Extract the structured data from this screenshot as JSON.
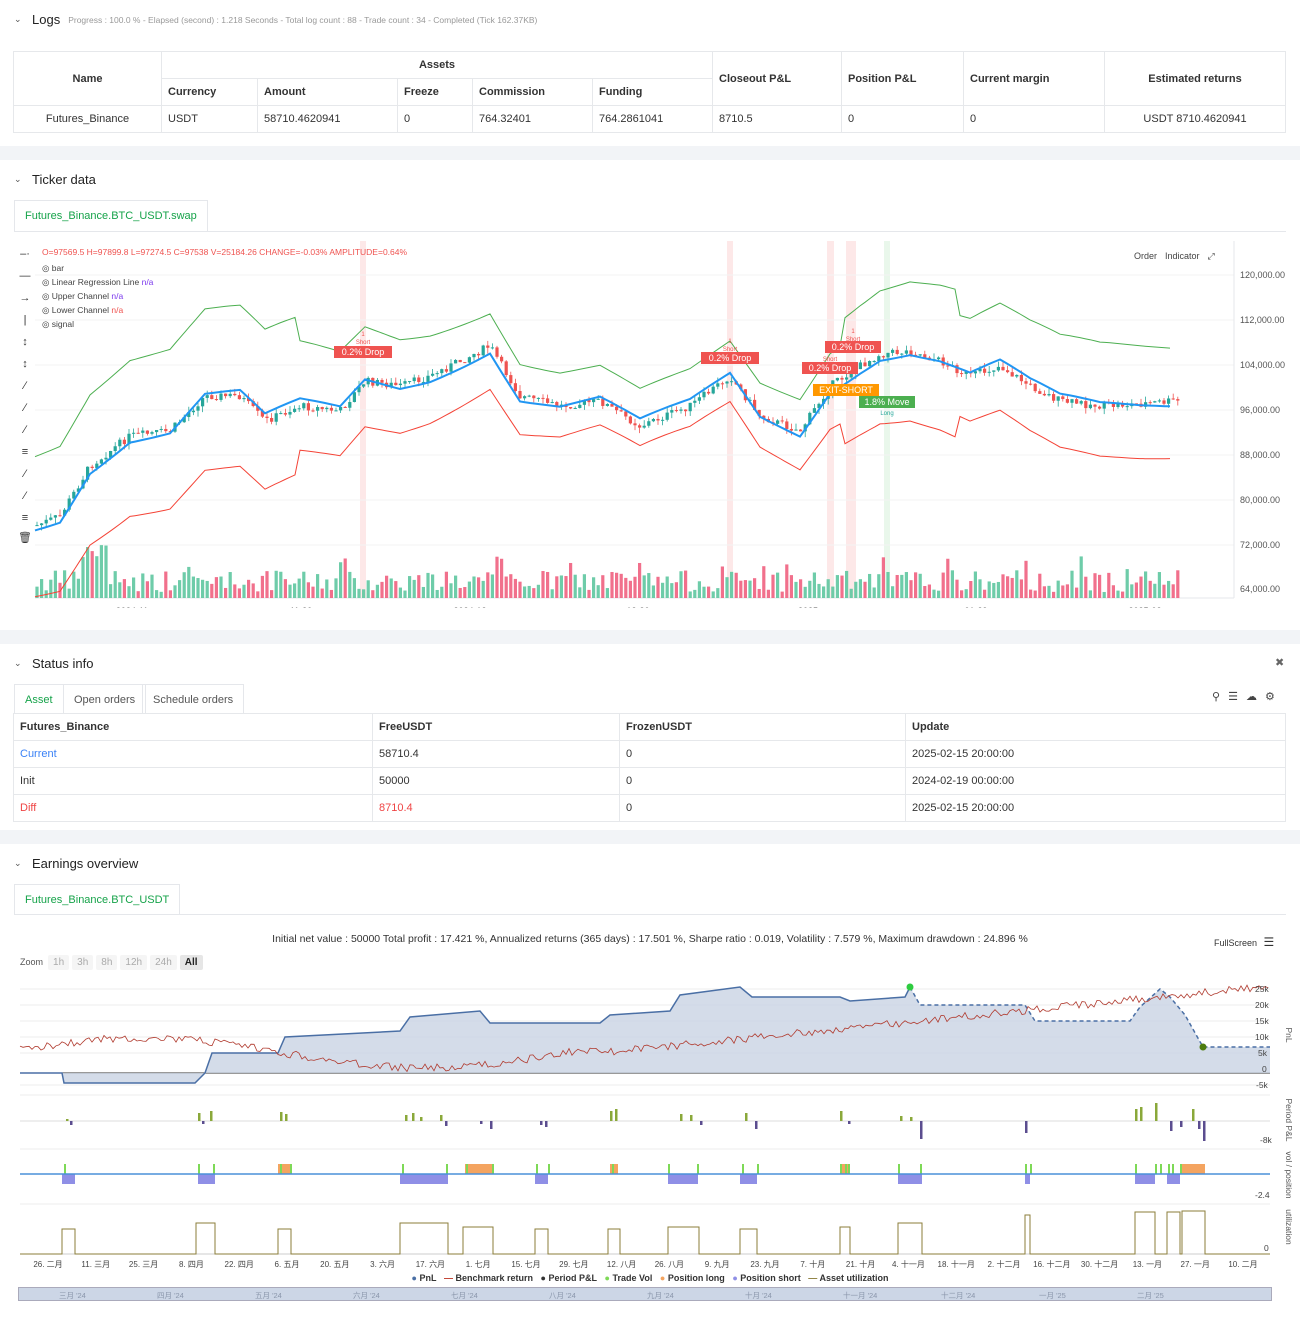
{
  "logs": {
    "title": "Logs",
    "progress": "Progress : 100.0 % - Elapsed (second) : 1.218  Seconds - Total log count : 88 - Trade count : 34 - Completed (Tick 162.37KB)"
  },
  "assets_table": {
    "headers": {
      "name": "Name",
      "assets": "Assets",
      "currency": "Currency",
      "amount": "Amount",
      "freeze": "Freeze",
      "commission": "Commission",
      "funding": "Funding",
      "closeout": "Closeout P&L",
      "position": "Position P&L",
      "margin": "Current margin",
      "returns": "Estimated returns"
    },
    "row": {
      "name": "Futures_Binance",
      "currency": "USDT",
      "amount": "58710.4620941",
      "freeze": "0",
      "commission": "764.32401",
      "funding": "764.2861041",
      "closeout": "8710.5",
      "position": "0",
      "margin": "0",
      "returns": "USDT 8710.4620941"
    }
  },
  "ticker": {
    "title": "Ticker data",
    "tab": "Futures_Binance.BTC_USDT.swap",
    "ohlc": "O=97569.5 H=97899.8 L=97274.5 C=97538 V=25184.26 CHANGE=-0.03% AMPLITUDE=0.64%",
    "legend": [
      {
        "label": "bar",
        "value": ""
      },
      {
        "label": "Linear Regression Line",
        "value": "n/a"
      },
      {
        "label": "Upper Channel",
        "value": "n/a"
      },
      {
        "label": "Lower Channel",
        "value": "n/a"
      },
      {
        "label": "signal",
        "value": ""
      }
    ],
    "order_btn": "Order",
    "indicator_btn": "Indicator",
    "y_ticks": [
      "120,000.00",
      "112,000.00",
      "104,000.00",
      "96,000.00",
      "88,000.00",
      "80,000.00",
      "72,000.00",
      "64,000.00"
    ],
    "x_ticks": [
      "2024-11",
      "11-30",
      "2024-12",
      "12-30",
      "2025",
      "01-29",
      "2025-02"
    ],
    "annotations": {
      "drop1": "0.2% Drop",
      "drop2": "0.2% Drop",
      "drop3": "0.2% Drop",
      "drop4": "0.2% Drop",
      "exit": "EXIT-SHORT",
      "move": "1.8% Move",
      "short": "Short",
      "long": "Long",
      "one": "1"
    },
    "colors": {
      "up": "#26a69a",
      "down": "#ef5350",
      "upper": "#4caf50",
      "lower": "#f44336",
      "reg": "#2196f3"
    }
  },
  "status": {
    "title": "Status info",
    "tabs": [
      "Asset",
      "Open orders",
      "Schedule orders"
    ],
    "headers": [
      "Futures_Binance",
      "FreeUSDT",
      "FrozenUSDT",
      "Update"
    ],
    "rows": [
      [
        "Current",
        "58710.4",
        "0",
        "2025-02-15 20:00:00"
      ],
      [
        "Init",
        "50000",
        "0",
        "2024-02-19 00:00:00"
      ],
      [
        "Diff",
        "8710.4",
        "0",
        "2025-02-15 20:00:00"
      ]
    ]
  },
  "earnings": {
    "title": "Earnings overview",
    "tab": "Futures_Binance.BTC_USDT",
    "summary": "Initial net value : 50000  Total profit : 17.421 %, Annualized returns (365 days) : 17.501 %, Sharpe ratio : 0.019, Volatility : 7.579 %, Maximum drawdown : 24.896 %",
    "fullscreen": "FullScreen",
    "zoom_label": "Zoom",
    "zoom_opts": [
      "1h",
      "3h",
      "8h",
      "12h",
      "24h",
      "All"
    ],
    "pnl_ticks": [
      "25k",
      "20k",
      "15k",
      "10k",
      "5k",
      "0",
      "-5k"
    ],
    "pnl_axis": "PnL",
    "period_axis": "Period P&L",
    "period_tick": "-8k",
    "vol_axis": "vol / position",
    "vol_tick": "-2.4",
    "util_axis": "utilization",
    "util_tick": "0",
    "x_ticks": [
      "26. 二月",
      "11. 三月",
      "25. 三月",
      "8. 四月",
      "22. 四月",
      "6. 五月",
      "20. 五月",
      "3. 六月",
      "17. 六月",
      "1. 七月",
      "15. 七月",
      "29. 七月",
      "12. 八月",
      "26. 八月",
      "9. 九月",
      "23. 九月",
      "7. 十月",
      "21. 十月",
      "4. 十一月",
      "18. 十一月",
      "2. 十二月",
      "16. 十二月",
      "30. 十二月",
      "13. 一月",
      "27. 一月",
      "10. 二月"
    ],
    "nav_ticks": [
      "三月 '24",
      "四月 '24",
      "五月 '24",
      "六月 '24",
      "七月 '24",
      "八月 '24",
      "九月 '24",
      "十月 '24",
      "十一月 '24",
      "十二月 '24",
      "一月 '25",
      "二月 '25"
    ],
    "legend": [
      {
        "label": "PnL",
        "color": "#4a6fa5"
      },
      {
        "label": "Benchmark return",
        "color": "#c0392b"
      },
      {
        "label": "Period P&L",
        "color": "#333333"
      },
      {
        "label": "Trade Vol",
        "color": "#7ed957"
      },
      {
        "label": "Position long",
        "color": "#f4a460"
      },
      {
        "label": "Position short",
        "color": "#8f8fe6"
      },
      {
        "label": "Asset utilization",
        "color": "#8b7d3a"
      }
    ]
  }
}
